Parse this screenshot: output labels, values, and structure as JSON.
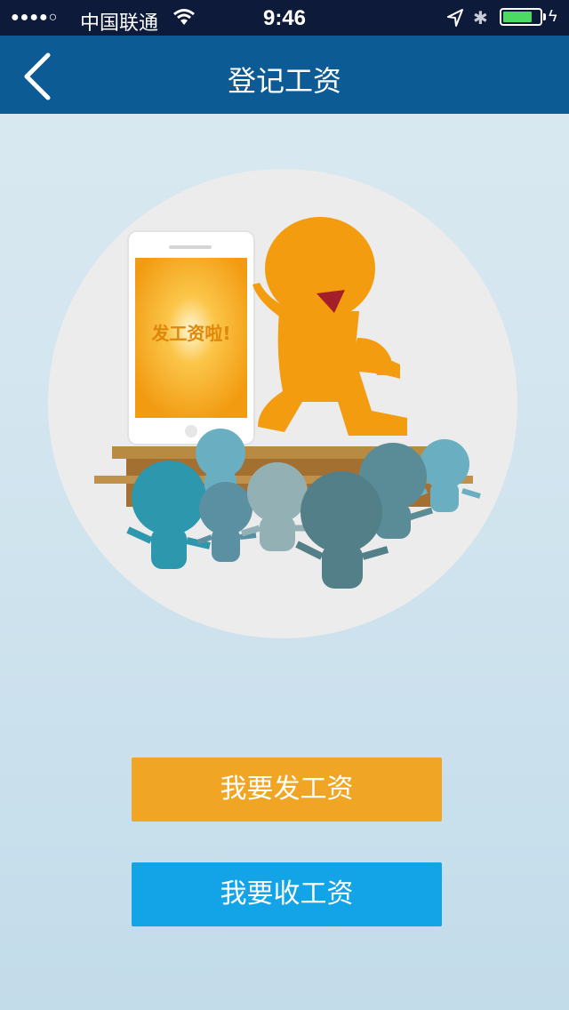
{
  "status_bar": {
    "signal": "●●●●○",
    "carrier": "中国联通",
    "time": "9:46",
    "battery_level": 0.8
  },
  "nav": {
    "title": "登记工资",
    "back_icon": "chevron-left-icon"
  },
  "illustration": {
    "phone_screen_text": "发工资啦!"
  },
  "actions": {
    "send_salary": "我要发工资",
    "receive_salary": "我要收工资"
  },
  "colors": {
    "navbar": "#0c5b95",
    "send_button": "#f0a624",
    "receive_button": "#12a4e6",
    "mascot": "#f39c0f"
  }
}
